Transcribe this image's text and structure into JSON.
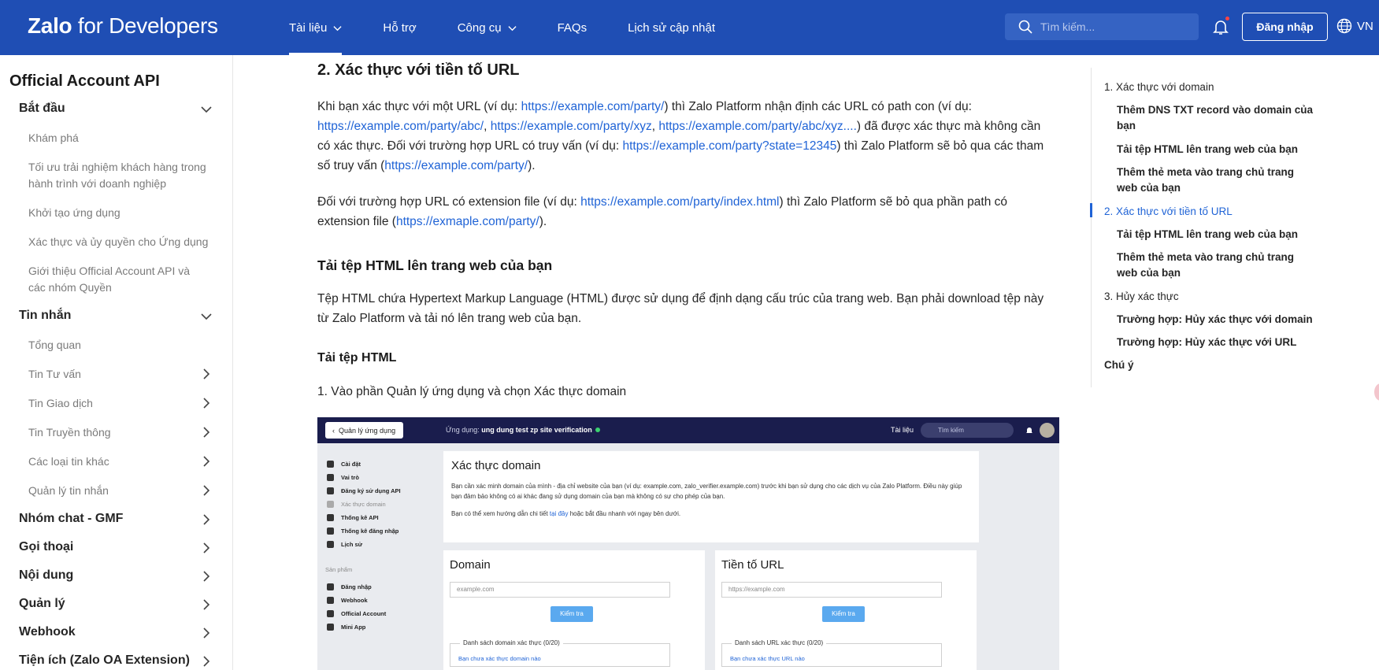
{
  "header": {
    "logo_main": "Zalo",
    "logo_sub": "for Developers",
    "nav": [
      {
        "label": "Tài liệu",
        "has_dropdown": true,
        "active": true
      },
      {
        "label": "Hỗ trợ",
        "has_dropdown": false
      },
      {
        "label": "Công cụ",
        "has_dropdown": true
      },
      {
        "label": "FAQs",
        "has_dropdown": false
      },
      {
        "label": "Lịch sử cập nhật",
        "has_dropdown": false
      }
    ],
    "search_placeholder": "Tìm kiếm...",
    "login_label": "Đăng nhập",
    "language": "VN"
  },
  "sidebar": {
    "title": "Official Account API",
    "sections": [
      {
        "label": "Bắt đầu",
        "arrow": "chevron-down-icon"
      },
      {
        "label": "Tin nhắn",
        "arrow": "chevron-down-icon"
      },
      {
        "label": "Nhóm chat - GMF",
        "arrow": "chevron-right-icon"
      },
      {
        "label": "Gọi thoại",
        "arrow": "chevron-right-icon"
      },
      {
        "label": "Nội dung",
        "arrow": "chevron-right-icon"
      },
      {
        "label": "Quản lý",
        "arrow": "chevron-right-icon"
      },
      {
        "label": "Webhook",
        "arrow": "chevron-right-icon"
      },
      {
        "label": "Tiện ích (Zalo OA Extension)",
        "arrow": "chevron-right-icon"
      }
    ],
    "start_items": [
      "Khám phá",
      "Tối ưu trải nghiệm khách hàng trong hành trình với doanh nghiệp",
      "Khởi tạo ứng dụng",
      "Xác thực và ủy quyền cho Ứng dụng",
      "Giới thiệu Official Account API và các nhóm Quyền"
    ],
    "message_items": [
      {
        "label": "Tổng quan",
        "has_arrow": false
      },
      {
        "label": "Tin Tư vấn",
        "has_arrow": true
      },
      {
        "label": "Tin Giao dịch",
        "has_arrow": true
      },
      {
        "label": "Tin Truyền thông",
        "has_arrow": true
      },
      {
        "label": "Các loại tin khác",
        "has_arrow": true
      },
      {
        "label": "Quản lý tin nhắn",
        "has_arrow": true
      }
    ]
  },
  "content": {
    "heading": "2. Xác thực với tiền tố URL",
    "p1": {
      "t1": "Khi bạn xác thực với một URL (ví dụ: ",
      "l1": "https://example.com/party/",
      "t2": ") thì Zalo Platform nhận định các URL có path con (ví dụ: ",
      "l2": "https://example.com/party/abc/",
      "t3": ", ",
      "l3": "https://example.com/party/xyz",
      "t4": ", ",
      "l4": "https://example.com/party/abc/xyz....",
      "t5": ") đã được xác thực mà không cần có xác thực. Đối với trường hợp URL có truy vấn (ví dụ: ",
      "l5": "https://example.com/party?state=12345",
      "t6": ") thì Zalo Platform sẽ bỏ qua các tham số truy vấn (",
      "l6": "https://example.com/party/",
      "t7": ")."
    },
    "p2": {
      "t1": "Đối với trường hợp URL có extension file (ví dụ: ",
      "l1": "https://example.com/party/index.html",
      "t2": ") thì Zalo Platform sẽ bỏ qua phần path có extension file (",
      "l2": "https://exmaple.com/party/",
      "t3": ")."
    },
    "subheading": "Tải tệp HTML lên trang web của bạn",
    "p3": "Tệp HTML chứa Hypertext Markup Language (HTML) được sử dụng để định dạng cấu trúc của trang web. Bạn phải download tệp này từ Zalo Platform và tải nó lên trang web của bạn.",
    "subsubheading": "Tải tệp HTML",
    "step1": "1.  Vào phần Quản lý ứng dụng và chọn Xác thực domain"
  },
  "screenshot": {
    "back_label": "Quản lý ứng dụng",
    "app_prefix": "Ứng dụng: ",
    "app_name": "ung dung test zp site verification",
    "docs": "Tài liệu",
    "search_placeholder": "Tìm kiếm",
    "side_items": [
      {
        "label": "Cài đặt",
        "dim": false
      },
      {
        "label": "Vai trò",
        "dim": false
      },
      {
        "label": "Đăng ký sử dụng API",
        "dim": false
      },
      {
        "label": "Xác thực domain",
        "dim": true
      },
      {
        "label": "Thống kê API",
        "dim": false
      },
      {
        "label": "Thống kê đăng nhập",
        "dim": false
      },
      {
        "label": "Lịch sử",
        "dim": false
      }
    ],
    "products_label": "Sản phẩm",
    "product_items": [
      "Đăng nhập",
      "Webhook",
      "Official Account",
      "Mini App"
    ],
    "card_title": "Xác thực domain",
    "card_p1": "Bạn cần xác minh domain của mình - địa chỉ website của bạn (ví dụ: example.com, zalo_verifier.example.com) trước khi bạn sử dụng cho các dịch vụ của Zalo Platform. Điều này giúp bạn đảm bảo không có ai khác đang sử dụng domain của bạn mà không có sự cho phép của bạn.",
    "card_p2_a": "Bạn có thể xem hướng dẫn chi tiết ",
    "card_p2_link": "tại đây",
    "card_p2_b": " hoặc bắt đầu nhanh với ngay bên dưới.",
    "domain_title": "Domain",
    "domain_placeholder": "example.com",
    "check_label": "Kiểm tra",
    "domain_list_title": "Danh sách domain xác thực (0/20)",
    "domain_list_empty": "Bạn chưa xác thực domain nào",
    "url_title": "Tiền tố URL",
    "url_placeholder": "https://example.com",
    "url_list_title": "Danh sách URL xác thực (0/20)",
    "url_list_empty": "Bạn chưa xác thực URL nào"
  },
  "toc": {
    "items": [
      {
        "label": "1. Xác thực với domain",
        "level": 1
      },
      {
        "label": "Thêm DNS TXT record vào domain của bạn",
        "level": 2
      },
      {
        "label": "Tải tệp HTML lên trang web của bạn",
        "level": 2
      },
      {
        "label": "Thêm thẻ meta vào trang chủ trang web của bạn",
        "level": 2
      },
      {
        "label": "2. Xác thực với tiền tố URL",
        "level": 1,
        "active": true
      },
      {
        "label": "Tải tệp HTML lên trang web của bạn",
        "level": 2
      },
      {
        "label": "Thêm thẻ meta vào trang chủ trang web của bạn",
        "level": 2
      },
      {
        "label": "3. Hủy xác thực",
        "level": 1
      },
      {
        "label": "Trường hợp: Hủy xác thực với domain",
        "level": 2
      },
      {
        "label": "Trường hợp: Hủy xác thực với URL",
        "level": 2
      },
      {
        "label": "Chú ý",
        "level": 1
      }
    ]
  },
  "colors": {
    "header_bg": "#1f4eb4",
    "link": "#1f63d6",
    "text": "#262626"
  }
}
